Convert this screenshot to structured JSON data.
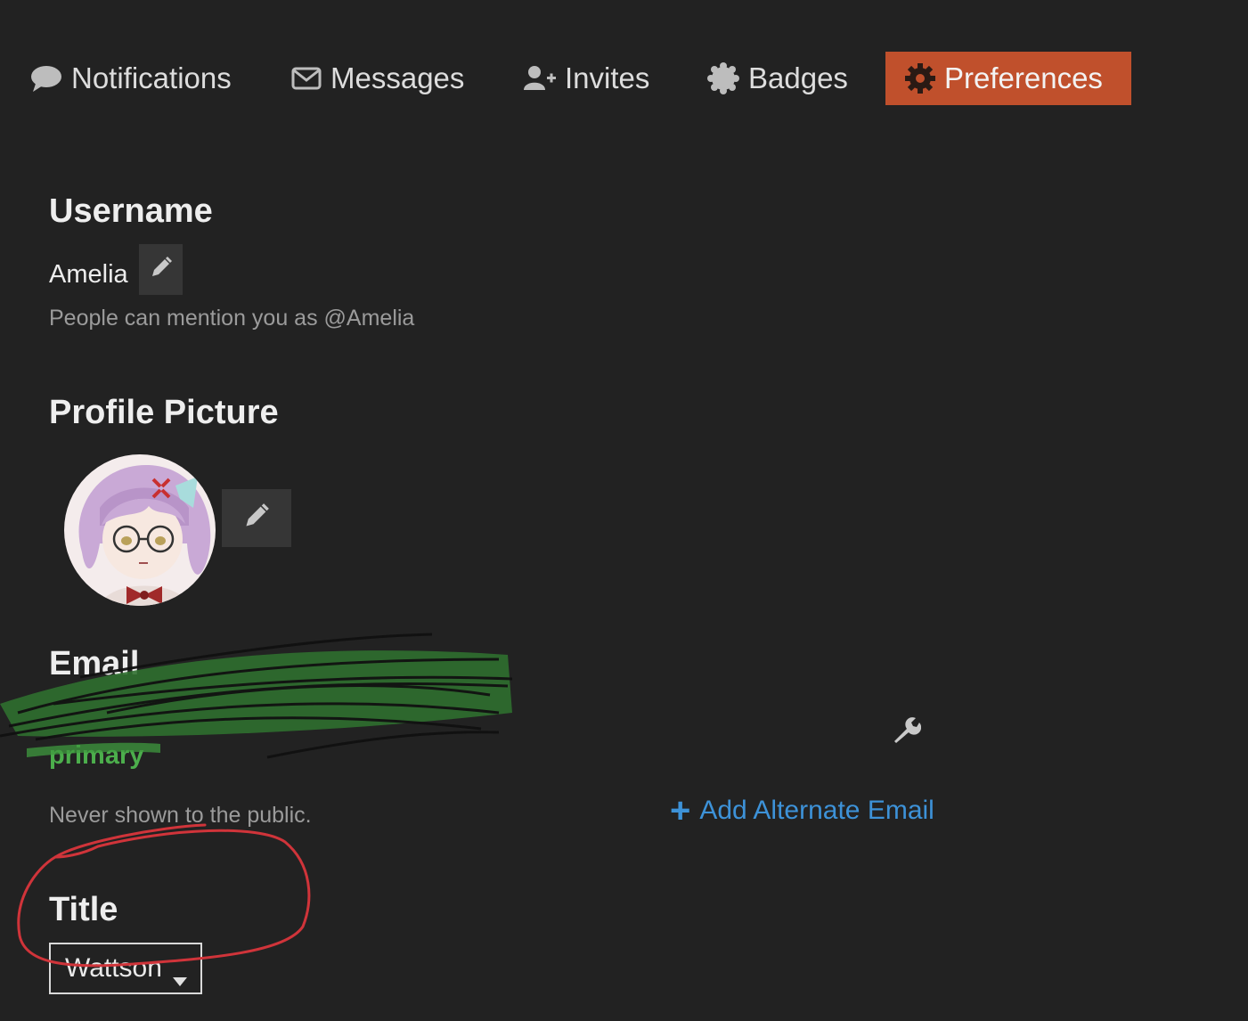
{
  "nav": {
    "items": [
      {
        "label": "Notifications",
        "icon": "speech-bubble-icon"
      },
      {
        "label": "Messages",
        "icon": "envelope-icon"
      },
      {
        "label": "Invites",
        "icon": "user-plus-icon"
      },
      {
        "label": "Badges",
        "icon": "badge-icon"
      },
      {
        "label": "Preferences",
        "icon": "gear-icon",
        "active": true
      }
    ]
  },
  "username": {
    "heading": "Username",
    "value": "Amelia",
    "hint": "People can mention you as @Amelia"
  },
  "profile_picture": {
    "heading": "Profile Picture"
  },
  "email": {
    "heading": "Email",
    "primary_tag": "primary",
    "hint": "Never shown to the public.",
    "add_alternate_label": "Add Alternate Email"
  },
  "title": {
    "heading": "Title",
    "selected": "Wattson"
  },
  "colors": {
    "background": "#222222",
    "accent_active_tab": "#c0502c",
    "link": "#3d92d8",
    "primary_tag": "#4cae4c",
    "annotation_circle": "#d0343a",
    "scribble_green": "#3f9a3f"
  }
}
